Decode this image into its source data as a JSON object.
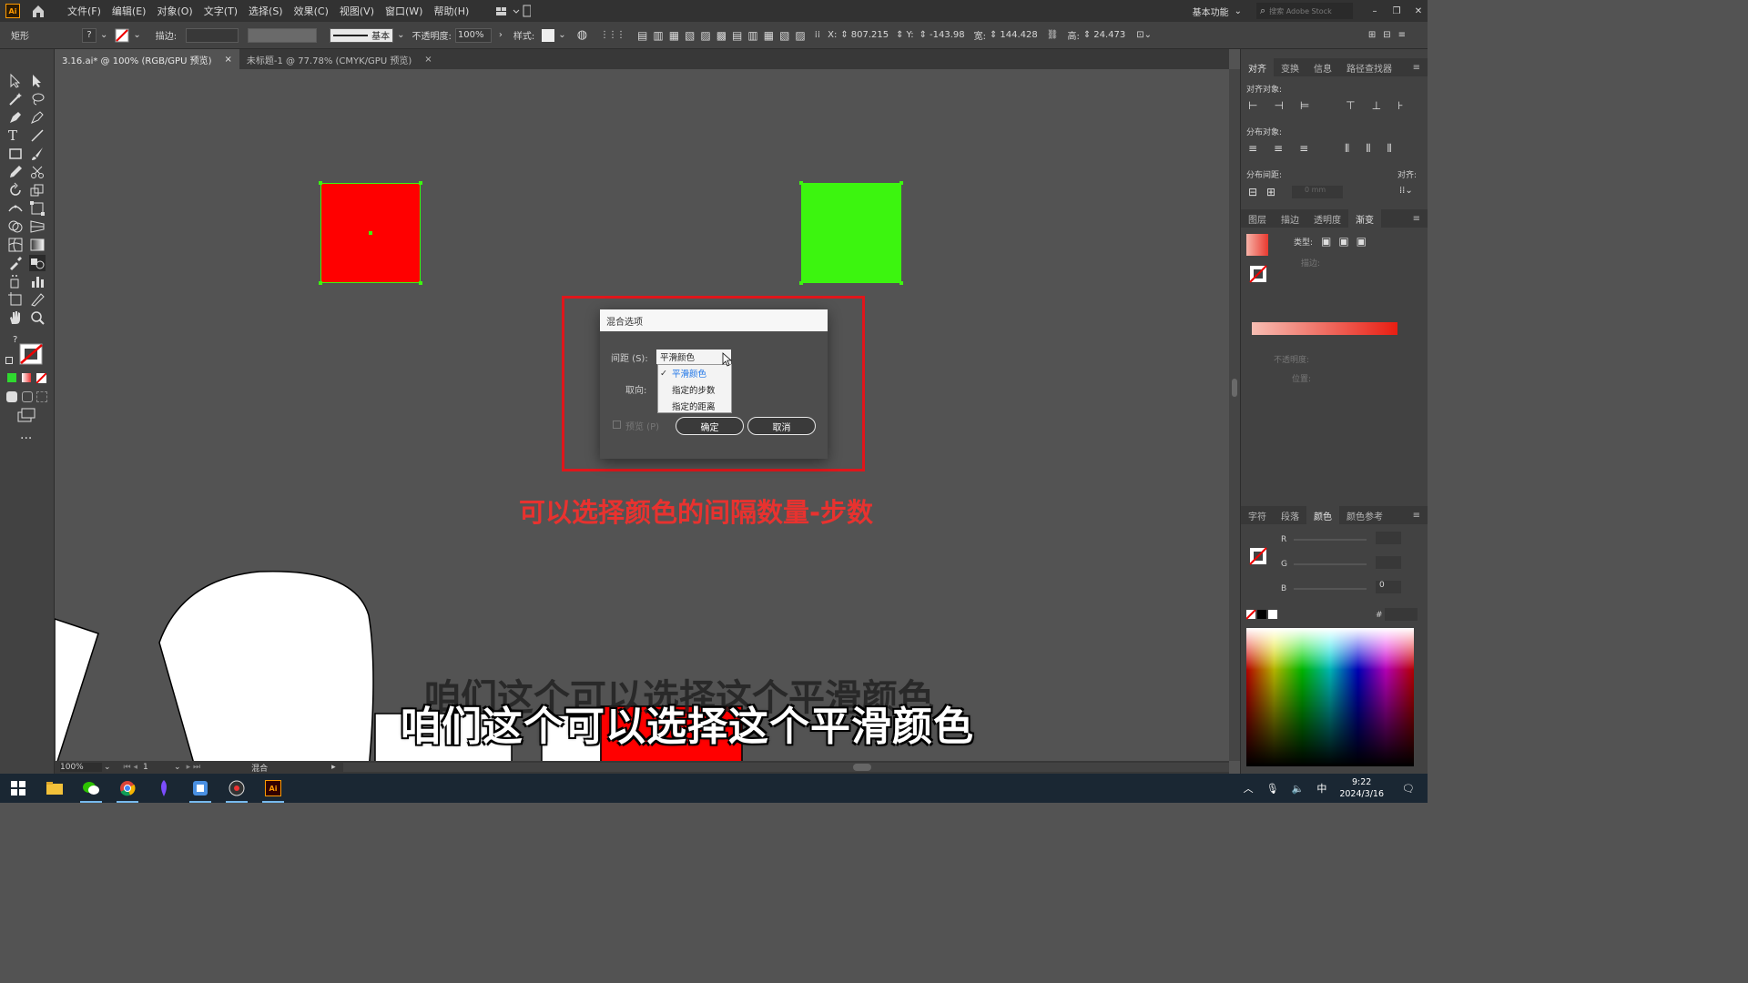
{
  "menubar": {
    "logo": "Ai",
    "items": [
      "文件(F)",
      "编辑(E)",
      "对象(O)",
      "文字(T)",
      "选择(S)",
      "效果(C)",
      "视图(V)",
      "窗口(W)",
      "帮助(H)"
    ],
    "workspace": "基本功能",
    "search_placeholder": "搜索 Adobe Stock"
  },
  "control": {
    "object_type": "矩形",
    "stroke_label": "描边:",
    "stroke_style": "基本",
    "opacity_label": "不透明度:",
    "opacity_value": "100%",
    "style_label": "样式:",
    "x_label": "X:",
    "x_value": "807.215",
    "y_label": "Y:",
    "y_value": "-143.98",
    "w_label": "宽:",
    "w_value": "144.428",
    "h_label": "高:",
    "h_value": "24.473"
  },
  "tabs": [
    {
      "label": "3.16.ai* @ 100% (RGB/GPU 预览)",
      "close": "×"
    },
    {
      "label": "未标题-1 @ 77.78% (CMYK/GPU 预览)",
      "close": "×"
    }
  ],
  "dialog": {
    "title": "混合选项",
    "spacing_label": "间距 (S):",
    "spacing_value": "平滑颜色",
    "orientation_label": "取向:",
    "preview_label": "预览 (P)",
    "ok": "确定",
    "cancel": "取消",
    "options": [
      "平滑颜色",
      "指定的步数",
      "指定的距离"
    ],
    "check": "✓"
  },
  "annotation": "可以选择颜色的间隔数量-步数",
  "subtitle": "咱们这个可以选择这个平滑颜色",
  "panels": {
    "align_tabs": [
      "对齐",
      "变换",
      "信息",
      "路径查找器"
    ],
    "align_objects": "对齐对象:",
    "distribute_objects": "分布对象:",
    "distribute_spacing": "分布间距:",
    "align_to": "对齐:",
    "spacing_placeholder": "0 mm",
    "gradient_tabs": [
      "图层",
      "描边",
      "透明度",
      "渐变"
    ],
    "gradient_type": "类型:",
    "gradient_stroke": "描边:",
    "gradient_opacity": "不透明度:",
    "gradient_position": "位置:",
    "color_tabs": [
      "字符",
      "段落",
      "颜色",
      "颜色参考"
    ],
    "channels": [
      "R",
      "G",
      "B"
    ],
    "b_value": "0",
    "hex": "#"
  },
  "status": {
    "zoom": "100%",
    "page": "1",
    "tool": "混合"
  },
  "taskbar": {
    "time": "9:22",
    "date": "2024/3/16",
    "ime": "中"
  },
  "colors": {
    "red": "#ff0000",
    "green": "#3cf50f",
    "annotation": "#e8322f",
    "highlight_border": "#e0161b"
  }
}
